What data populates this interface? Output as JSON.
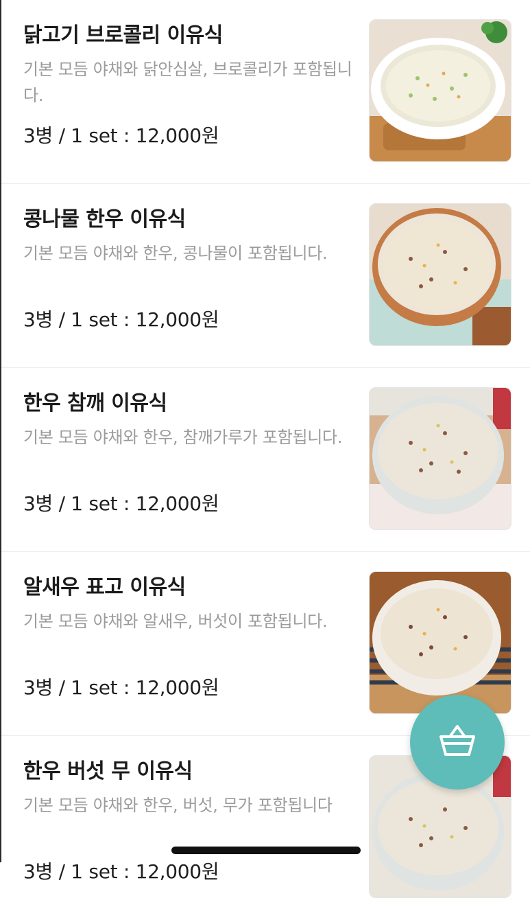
{
  "menu": {
    "items": [
      {
        "name": "닭고기 브로콜리 이유식",
        "desc": "기본 모듬 야채와 닭안심살, 브로콜리가 포함됩니다.",
        "price": "3병 / 1 set : 12,000원"
      },
      {
        "name": "콩나물 한우 이유식",
        "desc": "기본 모듬 야채와 한우, 콩나물이 포함됩니다.",
        "price": "3병 / 1 set : 12,000원"
      },
      {
        "name": "한우 참깨 이유식",
        "desc": "기본 모듬 야채와 한우, 참깨가루가 포함됩니다.",
        "price": "3병 / 1 set : 12,000원"
      },
      {
        "name": "알새우 표고 이유식",
        "desc": "기본 모듬 야채와 알새우, 버섯이 포함됩니다.",
        "price": "3병 / 1 set : 12,000원"
      },
      {
        "name": "한우 버섯 무 이유식",
        "desc": "기본 모듬 야채와 한우, 버섯, 무가 포함됩니다",
        "price": "3병 / 1 set : 12,000원"
      }
    ]
  },
  "icons": {
    "cart": "shopping-basket-icon"
  },
  "colors": {
    "cart_button": "#5fbdb9",
    "description_text": "#9c9c9c",
    "title_text": "#1b1b1b"
  }
}
